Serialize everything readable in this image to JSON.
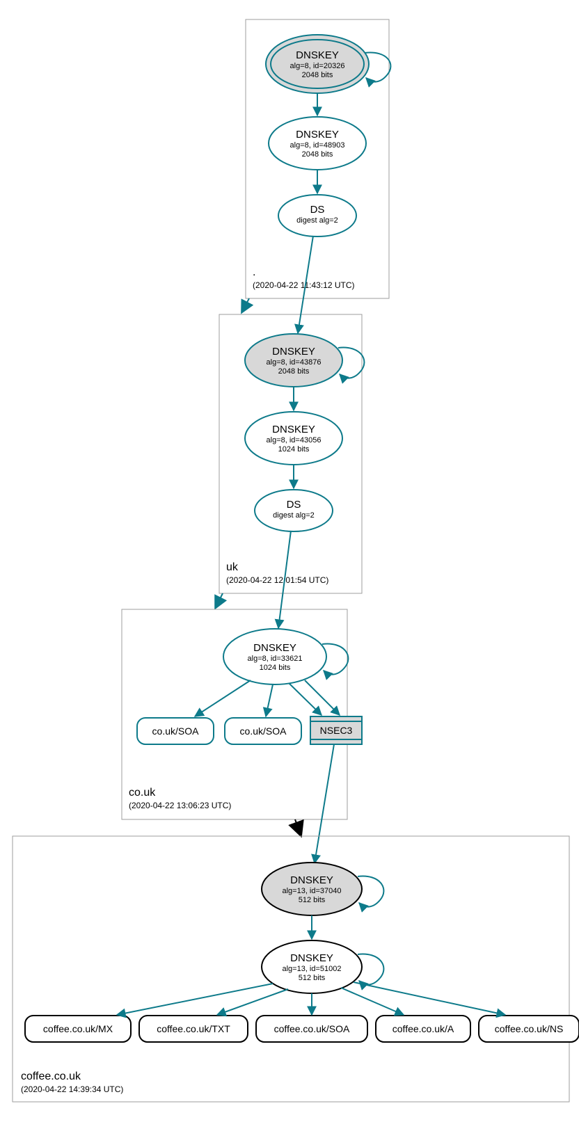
{
  "zones": {
    "root": {
      "name": ".",
      "timestamp": "(2020-04-22 11:43:12 UTC)",
      "ksk": {
        "title": "DNSKEY",
        "line1": "alg=8, id=20326",
        "line2": "2048 bits"
      },
      "zsk": {
        "title": "DNSKEY",
        "line1": "alg=8, id=48903",
        "line2": "2048 bits"
      },
      "ds": {
        "title": "DS",
        "line1": "digest alg=2"
      }
    },
    "uk": {
      "name": "uk",
      "timestamp": "(2020-04-22 12:01:54 UTC)",
      "ksk": {
        "title": "DNSKEY",
        "line1": "alg=8, id=43876",
        "line2": "2048 bits"
      },
      "zsk": {
        "title": "DNSKEY",
        "line1": "alg=8, id=43056",
        "line2": "1024 bits"
      },
      "ds": {
        "title": "DS",
        "line1": "digest alg=2"
      }
    },
    "couk": {
      "name": "co.uk",
      "timestamp": "(2020-04-22 13:06:23 UTC)",
      "key": {
        "title": "DNSKEY",
        "line1": "alg=8, id=33621",
        "line2": "1024 bits"
      },
      "soa1": "co.uk/SOA",
      "soa2": "co.uk/SOA",
      "nsec3": "NSEC3"
    },
    "coffee": {
      "name": "coffee.co.uk",
      "timestamp": "(2020-04-22 14:39:34 UTC)",
      "ksk": {
        "title": "DNSKEY",
        "line1": "alg=13, id=37040",
        "line2": "512 bits"
      },
      "zsk": {
        "title": "DNSKEY",
        "line1": "alg=13, id=51002",
        "line2": "512 bits"
      },
      "records": {
        "mx": "coffee.co.uk/MX",
        "txt": "coffee.co.uk/TXT",
        "soa": "coffee.co.uk/SOA",
        "a": "coffee.co.uk/A",
        "ns": "coffee.co.uk/NS"
      }
    }
  },
  "chart_data": {
    "type": "tree",
    "title": "DNSSEC authentication chain",
    "zones": [
      {
        "name": ".",
        "timestamp": "2020-04-22 11:43:12 UTC",
        "keys": [
          {
            "role": "KSK",
            "alg": 8,
            "id": 20326,
            "bits": 2048
          },
          {
            "role": "ZSK",
            "alg": 8,
            "id": 48903,
            "bits": 2048
          }
        ],
        "ds": {
          "digest_alg": 2
        }
      },
      {
        "name": "uk",
        "timestamp": "2020-04-22 12:01:54 UTC",
        "keys": [
          {
            "role": "KSK",
            "alg": 8,
            "id": 43876,
            "bits": 2048
          },
          {
            "role": "ZSK",
            "alg": 8,
            "id": 43056,
            "bits": 1024
          }
        ],
        "ds": {
          "digest_alg": 2
        }
      },
      {
        "name": "co.uk",
        "timestamp": "2020-04-22 13:06:23 UTC",
        "keys": [
          {
            "role": "KSK/ZSK",
            "alg": 8,
            "id": 33621,
            "bits": 1024
          }
        ],
        "records": [
          "co.uk/SOA",
          "co.uk/SOA",
          "NSEC3"
        ]
      },
      {
        "name": "coffee.co.uk",
        "timestamp": "2020-04-22 14:39:34 UTC",
        "keys": [
          {
            "role": "KSK",
            "alg": 13,
            "id": 37040,
            "bits": 512
          },
          {
            "role": "ZSK",
            "alg": 13,
            "id": 51002,
            "bits": 512
          }
        ],
        "records": [
          "coffee.co.uk/MX",
          "coffee.co.uk/TXT",
          "coffee.co.uk/SOA",
          "coffee.co.uk/A",
          "coffee.co.uk/NS"
        ]
      }
    ],
    "edges": [
      [
        ".KSK",
        ".KSK"
      ],
      [
        ".KSK",
        ".ZSK"
      ],
      [
        ".ZSK",
        ".DS"
      ],
      [
        ".DS",
        "uk.KSK"
      ],
      [
        "uk.KSK",
        "uk.KSK"
      ],
      [
        "uk.KSK",
        "uk.ZSK"
      ],
      [
        "uk.ZSK",
        "uk.DS"
      ],
      [
        "uk.DS",
        "co.uk.KEY"
      ],
      [
        "co.uk.KEY",
        "co.uk.KEY"
      ],
      [
        "co.uk.KEY",
        "co.uk/SOA"
      ],
      [
        "co.uk.KEY",
        "co.uk/SOA"
      ],
      [
        "co.uk.KEY",
        "NSEC3"
      ],
      [
        "NSEC3",
        "coffee.KSK"
      ],
      [
        "coffee.KSK",
        "coffee.KSK"
      ],
      [
        "coffee.KSK",
        "coffee.ZSK"
      ],
      [
        "coffee.ZSK",
        "coffee.ZSK"
      ],
      [
        "coffee.ZSK",
        "coffee.co.uk/MX"
      ],
      [
        "coffee.ZSK",
        "coffee.co.uk/TXT"
      ],
      [
        "coffee.ZSK",
        "coffee.co.uk/SOA"
      ],
      [
        "coffee.ZSK",
        "coffee.co.uk/A"
      ],
      [
        "coffee.ZSK",
        "coffee.co.uk/NS"
      ]
    ]
  }
}
